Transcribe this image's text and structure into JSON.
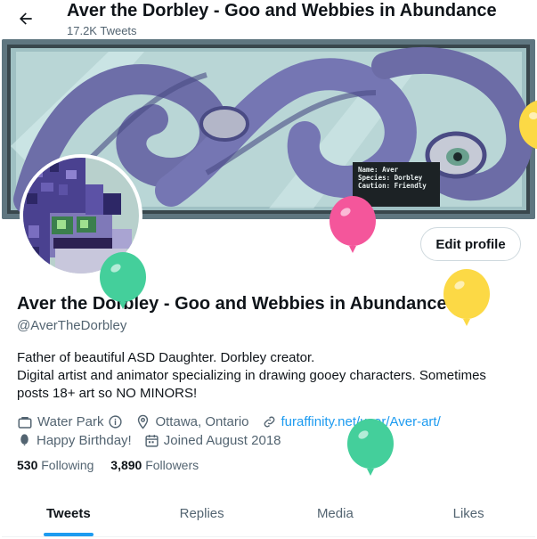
{
  "header": {
    "title": "Aver the Dorbley - Goo and Webbies in Abundance",
    "subtitle": "17.2K Tweets"
  },
  "banner": {
    "label_lines": [
      "Name:   Aver",
      "Species: Dorbley",
      "Caution: Friendly"
    ]
  },
  "profile": {
    "edit_label": "Edit profile",
    "display_name": "Aver the Dorbley - Goo and Webbies in Abundance",
    "handle": "@AverTheDorbley",
    "bio": [
      "Father of beautiful ASD Daughter. Dorbley creator.",
      "Digital artist and animator specializing in drawing gooey characters. Sometimes",
      "posts 18+ art so NO MINORS!"
    ],
    "professional_category": "Water Park",
    "location": "Ottawa, Ontario",
    "website": "furaffinity.net/user/Aver-art/",
    "birthday": "Happy Birthday!",
    "joined": "Joined August 2018",
    "following_count": "530",
    "following_label": "Following",
    "followers_count": "3,890",
    "followers_label": "Followers"
  },
  "tabs": [
    {
      "label": "Tweets",
      "active": true
    },
    {
      "label": "Replies",
      "active": false
    },
    {
      "label": "Media",
      "active": false
    },
    {
      "label": "Likes",
      "active": false
    }
  ],
  "colors": {
    "accent": "#1d9bf0",
    "text": "#0f1419",
    "secondary": "#536471",
    "balloon_green": "#44cf9b",
    "balloon_pink": "#f4569b",
    "balloon_yellow": "#fcd945"
  },
  "icons": {
    "back": "arrow-left-icon",
    "category": "briefcase-icon",
    "info": "info-icon",
    "location": "location-pin-icon",
    "link": "link-icon",
    "birthday": "balloon-icon",
    "calendar": "calendar-icon"
  }
}
